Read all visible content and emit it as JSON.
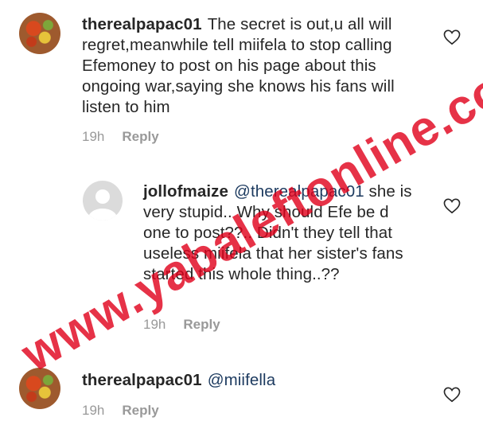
{
  "comments": [
    {
      "username": "therealpapac01",
      "text": "The secret is out,u all will regret,meanwhile tell miifela to stop calling Efemoney to post on his page about this ongoing war,saying she knows his fans will listen to him",
      "time": "19h",
      "reply_label": "Reply",
      "avatar_icon": "food-photo-avatar"
    },
    {
      "username": "jollofmaize",
      "mention": "@therealpapac01",
      "text": "she is very stupid.. Why should Efe be d one to post??.. Didn't they tell that useless miifela that her sister's fans started this whole thing..??",
      "time": "19h",
      "reply_label": "Reply",
      "avatar_icon": "default-profile-avatar"
    },
    {
      "username": "therealpapac01",
      "mention": "@miifella",
      "text": "",
      "time": "19h",
      "reply_label": "Reply",
      "avatar_icon": "food-photo-avatar"
    }
  ],
  "watermark": "www.yabaleftonline.com",
  "colors": {
    "text": "#262626",
    "meta": "#999999",
    "mention": "#1c3a5f",
    "watermark": "#e0001a"
  }
}
